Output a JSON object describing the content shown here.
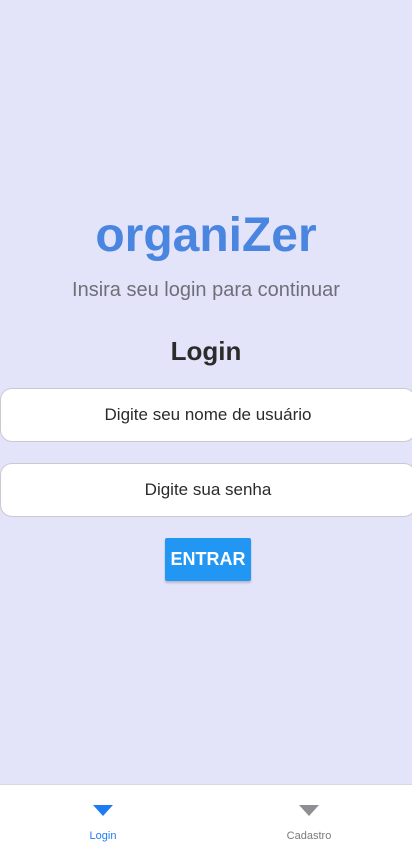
{
  "header": {
    "app_title": "organiZer",
    "subtitle": "Insira seu login para continuar"
  },
  "form": {
    "title": "Login",
    "username_placeholder": "Digite seu nome de usuário",
    "password_placeholder": "Digite sua senha",
    "submit_label": "ENTRAR"
  },
  "tabbar": {
    "tabs": [
      {
        "label": "Login",
        "icon": "triangle-down-icon",
        "active": true
      },
      {
        "label": "Cadastro",
        "icon": "triangle-down-icon",
        "active": false
      }
    ]
  },
  "colors": {
    "background": "#E3E4FA",
    "brand": "#4A86E0",
    "button": "#2196F3",
    "tab_active": "#1E7CF2",
    "tab_inactive": "#8E8E93"
  }
}
